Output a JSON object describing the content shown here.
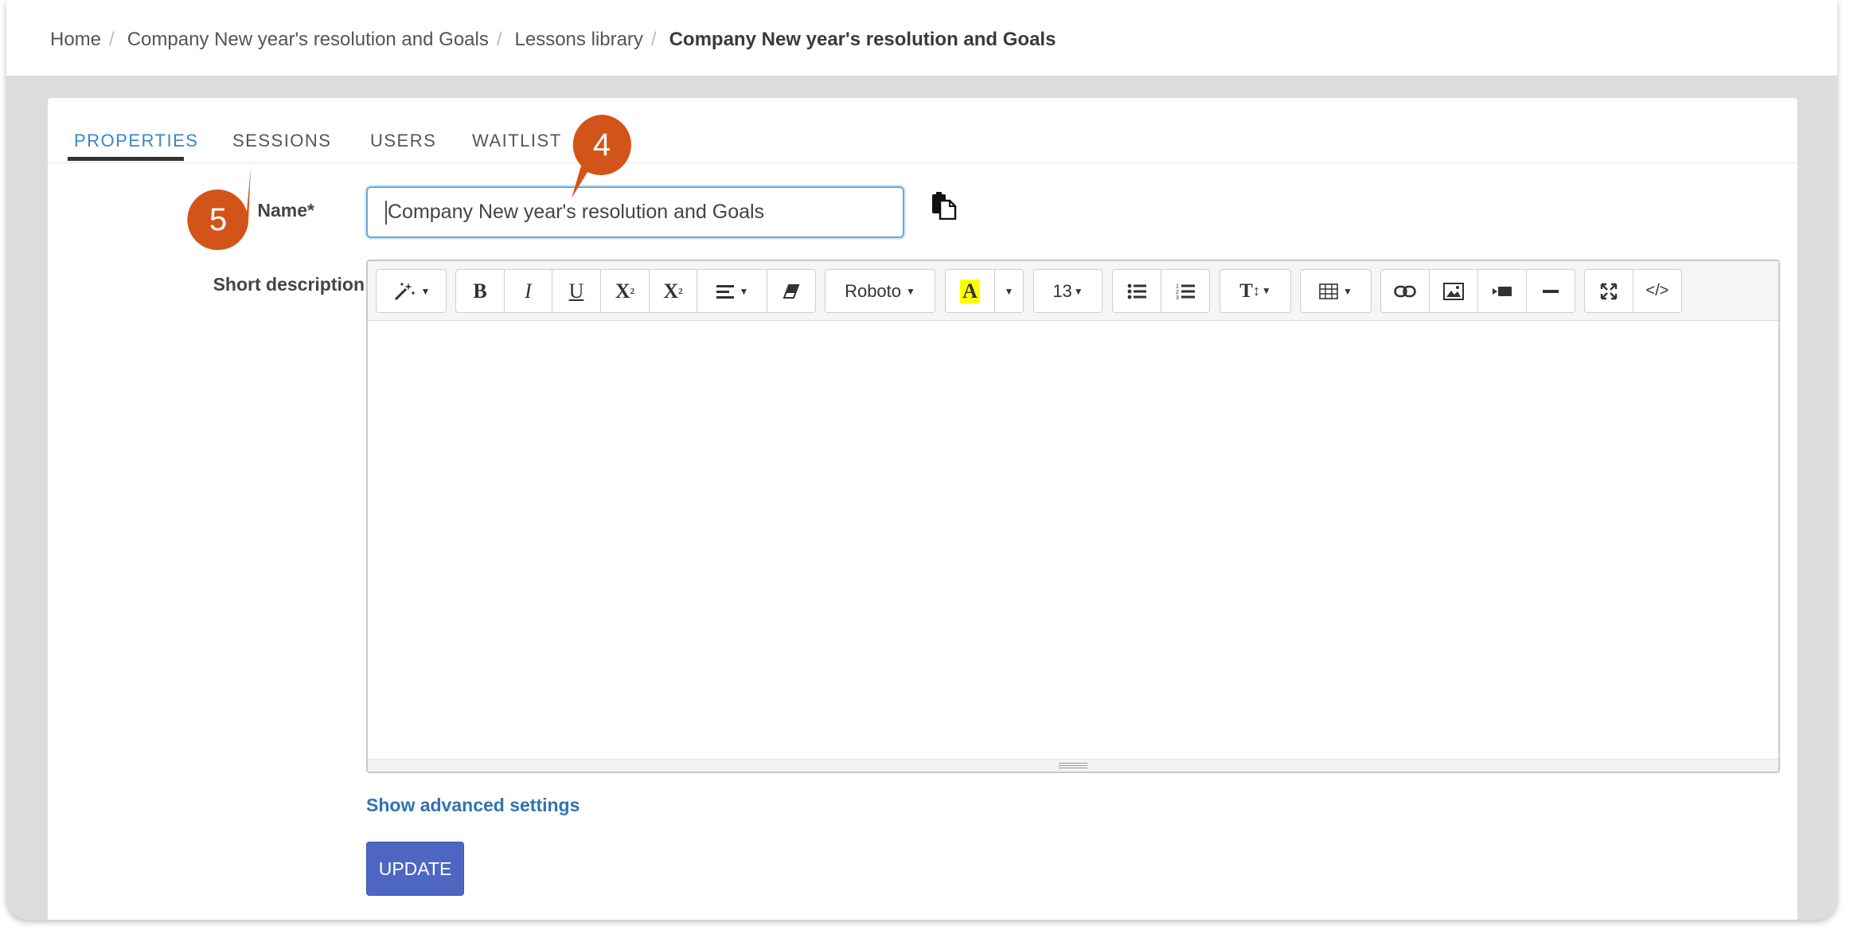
{
  "breadcrumb": {
    "items": [
      "Home",
      "Company New year's resolution and Goals",
      "Lessons library"
    ],
    "separator": "/",
    "current": "Company New year's resolution and Goals"
  },
  "tabs": [
    {
      "label": "PROPERTIES",
      "active": true
    },
    {
      "label": "SESSIONS",
      "active": false
    },
    {
      "label": "USERS",
      "active": false
    },
    {
      "label": "WAITLIST",
      "active": false
    }
  ],
  "form": {
    "name_label": "Name*",
    "name_value": "Company New year's resolution and Goals",
    "short_description_label": "Short description",
    "paste_icon": "paste-icon"
  },
  "editor_toolbar": {
    "style_icon": "magic-wand-icon",
    "bold": "B",
    "italic": "I",
    "underline": "U",
    "superscript": "X",
    "subscript": "X",
    "align_icon": "align-left-icon",
    "eraser_icon": "eraser-icon",
    "font_name": "Roboto",
    "color_letter": "A",
    "font_size": "13",
    "line_height": "T",
    "icons": [
      "table-icon",
      "link-icon",
      "image-icon",
      "video-icon",
      "horizontal-rule-icon",
      "fullscreen-icon"
    ],
    "code_view": "</>"
  },
  "actions": {
    "advanced_settings": "Show advanced settings",
    "update": "UPDATE"
  },
  "callouts": [
    "4",
    "5"
  ],
  "colors": {
    "accent_tab": "#3a86c8",
    "update_button": "#4d66c1",
    "link": "#3173b1",
    "callout": "#d35419"
  }
}
